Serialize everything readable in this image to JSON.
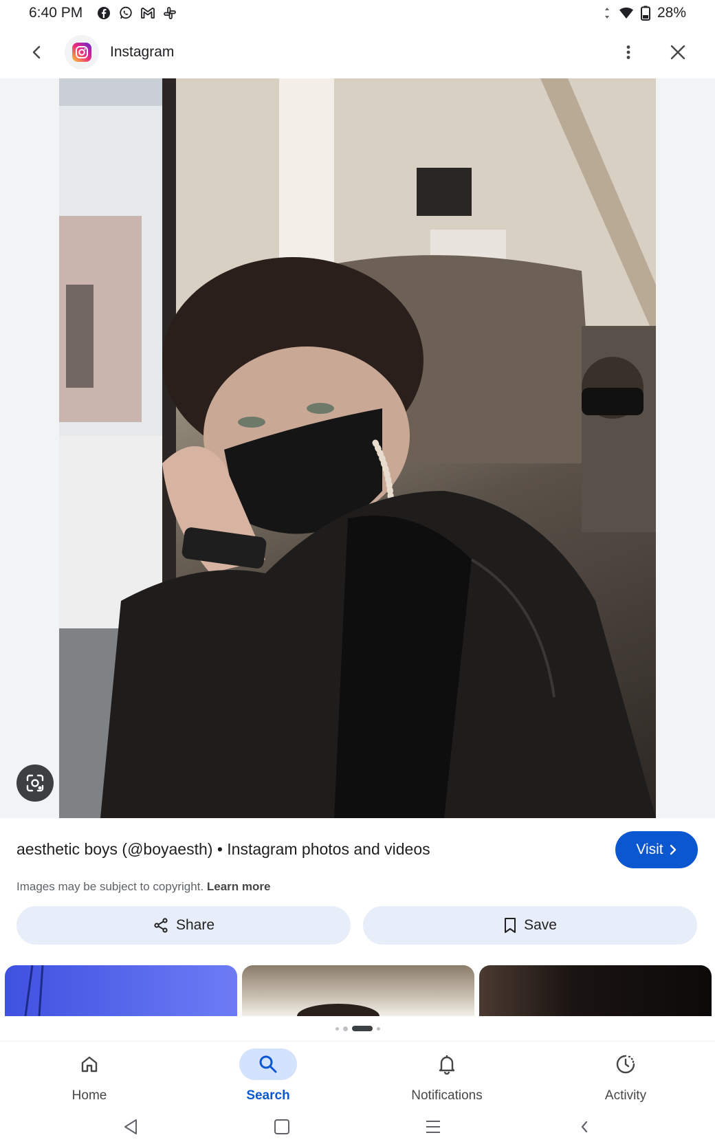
{
  "status_bar": {
    "time": "6:40 PM",
    "notification_icons": [
      "facebook-icon",
      "whatsapp-icon",
      "gmail-icon",
      "slack-icon"
    ],
    "battery": "28%"
  },
  "app_bar": {
    "site_name": "Instagram",
    "site_icon": "instagram-icon",
    "back_icon": "back-arrow-icon",
    "more_icon": "more-vert-icon",
    "close_icon": "close-icon"
  },
  "image": {
    "lens_icon": "lens-icon"
  },
  "info": {
    "title": "aesthetic boys (@boyaesth) • Instagram photos and videos",
    "visit_label": "Visit",
    "copyright_text": "Images may be subject to copyright.",
    "learn_more": "Learn more",
    "share_label": "Share",
    "save_label": "Save"
  },
  "carousel": {
    "dots": 4,
    "active_dot": 2
  },
  "bottom_nav": {
    "items": [
      {
        "label": "Home",
        "icon": "home-icon",
        "active": false
      },
      {
        "label": "Search",
        "icon": "search-icon",
        "active": true
      },
      {
        "label": "Notifications",
        "icon": "bell-icon",
        "active": false
      },
      {
        "label": "Activity",
        "icon": "activity-icon",
        "active": false
      }
    ]
  },
  "colors": {
    "accent": "#0b57d0",
    "pill_bg": "#e8eef9",
    "active_nav_bg": "#d3e3fd"
  }
}
